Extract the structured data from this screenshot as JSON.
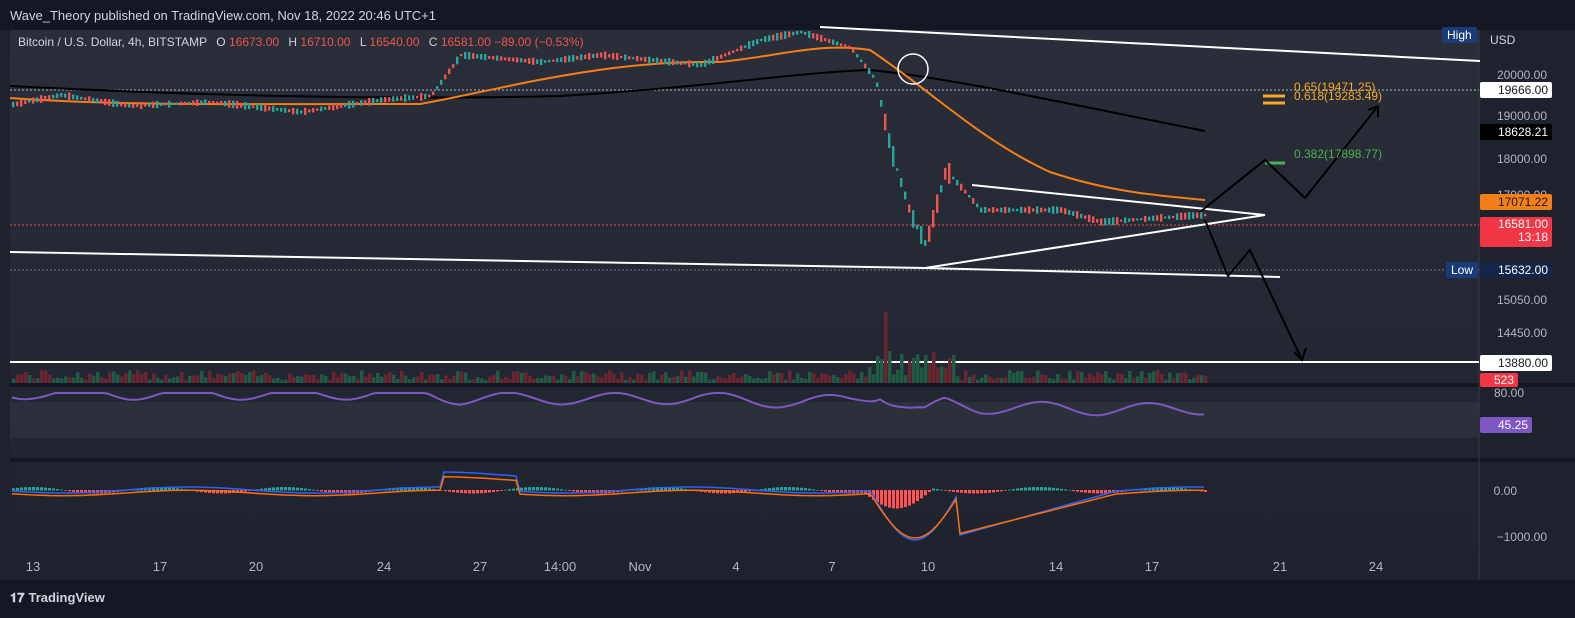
{
  "header": {
    "published": "Wave_Theory published on TradingView.com, Nov 18, 2022 20:46 UTC+1"
  },
  "legend": {
    "symbol": "Bitcoin / U.S. Dollar, 4h, BITSTAMP",
    "o_label": "O",
    "o_value": "16673.00",
    "h_label": "H",
    "h_value": "16710.00",
    "l_label": "L",
    "l_value": "16540.00",
    "c_label": "C",
    "c_value": "16581.00 −89.00 (−0.53%)"
  },
  "scale": {
    "currency": "USD",
    "ticks": [
      "20000.00",
      "19000.00",
      "18000.00",
      "17000.00",
      "15050.00",
      "14450.00",
      "80.00",
      "0.00",
      "−1000.00"
    ],
    "tags": {
      "dotted_level": "19666.00",
      "black_line": "18628.21",
      "orange_ma": "17071.22",
      "last_price": "16581.00",
      "countdown": "13:18",
      "low_value": "15632.00",
      "support": "13880.00",
      "volume": "523",
      "rsi": "45.25"
    },
    "high_label": "High",
    "low_label": "Low"
  },
  "fib": {
    "f065": "0.65(19471.25)",
    "f0618": "0.618(19283.49)",
    "f0382": "0.382(17898.77)"
  },
  "xaxis": {
    "labels": [
      "13",
      "17",
      "20",
      "24",
      "27",
      "14:00",
      "Nov",
      "4",
      "7",
      "10",
      "14",
      "17",
      "21",
      "24"
    ]
  },
  "colors": {
    "up": "#26a69a",
    "down": "#ef5350",
    "ma_orange": "#f57f17",
    "rsi": "#7e57c2",
    "macd_line": "#2962ff",
    "signal": "#ff6d00"
  },
  "footer": {
    "brand": "TradingView"
  }
}
